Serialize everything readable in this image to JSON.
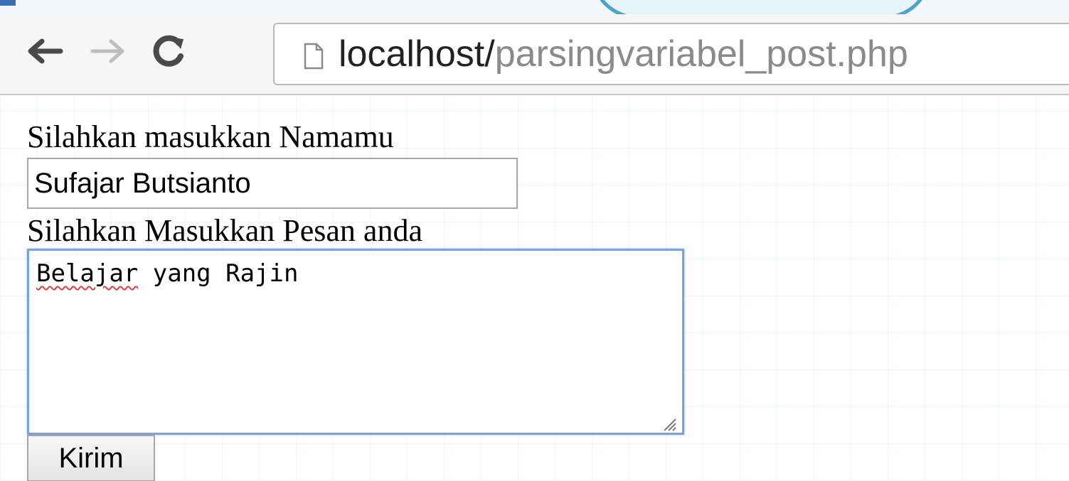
{
  "browser": {
    "url_host": "localhost/",
    "url_path": "parsingvariabel_post.php",
    "nav": {
      "back_icon": "back-arrow-icon",
      "forward_icon": "forward-arrow-icon",
      "reload_icon": "reload-icon"
    }
  },
  "form": {
    "name_label": "Silahkan masukkan Namamu",
    "name_value": "Sufajar Butsianto",
    "message_label": "Silahkan Masukkan Pesan anda",
    "message_words": {
      "misspelled": "Belajar",
      "rest": " yang Rajin"
    },
    "submit_label": "Kirim"
  },
  "colors": {
    "focus_border": "#7aa2e3",
    "url_host": "#222222",
    "url_path": "#8a8a8a",
    "spellcheck": "#e04040"
  }
}
